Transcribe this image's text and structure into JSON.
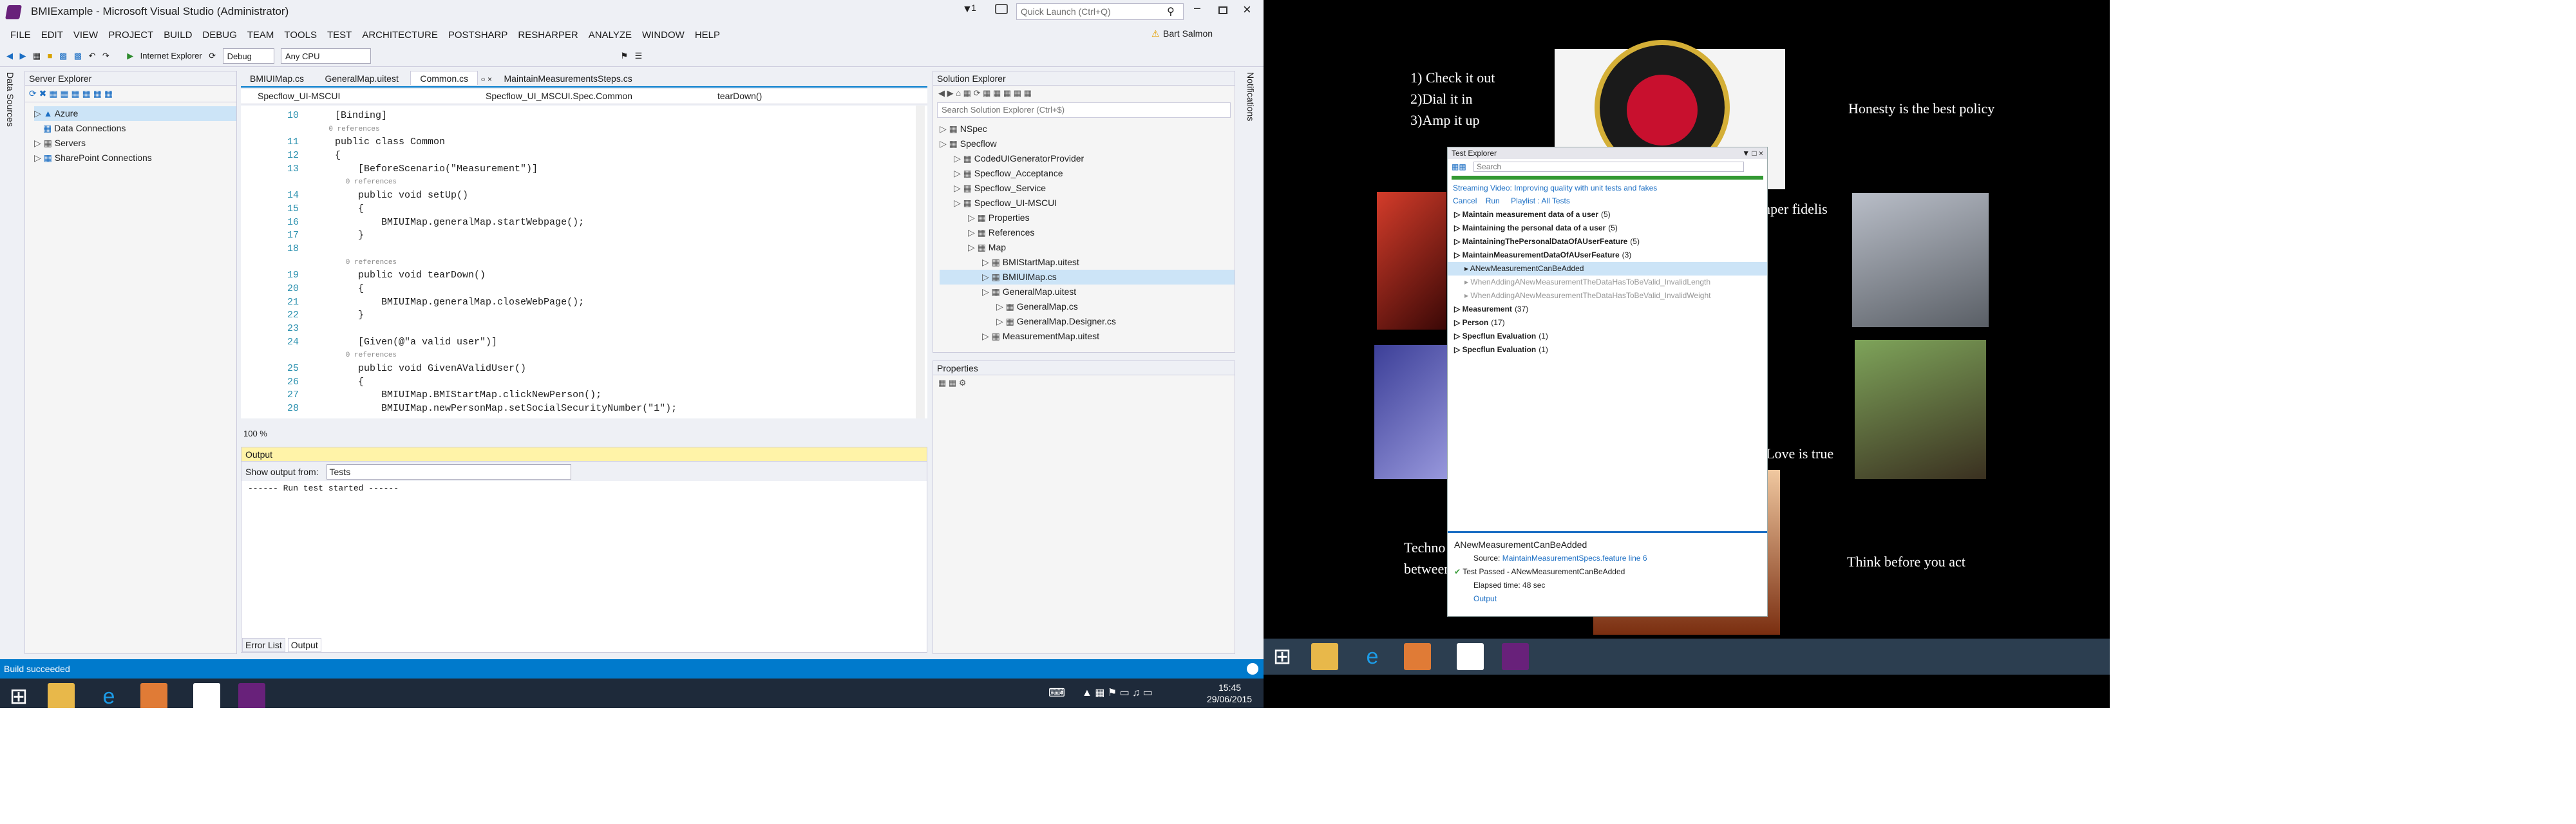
{
  "window": {
    "title": "BMIExample - Microsoft Visual Studio (Administrator)",
    "notif_count": "1",
    "quick_launch_placeholder": "Quick Launch (Ctrl+Q)",
    "user": "Bart Salmon"
  },
  "menu": [
    "FILE",
    "EDIT",
    "VIEW",
    "PROJECT",
    "BUILD",
    "DEBUG",
    "TEAM",
    "TOOLS",
    "TEST",
    "ARCHITECTURE",
    "POSTSHARP",
    "RESHARPER",
    "ANALYZE",
    "WINDOW",
    "HELP"
  ],
  "toolbar": {
    "browser": "Internet Explorer",
    "config": "Debug",
    "platform": "Any CPU"
  },
  "server_explorer": {
    "title": "Server Explorer",
    "items": [
      "Azure",
      "Data Connections",
      "Servers",
      "SharePoint Connections"
    ]
  },
  "side_tabs": {
    "left": "Data Sources",
    "right": "Notifications"
  },
  "editor": {
    "tabs": [
      "BMIUIMap.cs",
      "GeneralMap.uitest",
      "Common.cs",
      "MaintainMeasurementsSteps.cs"
    ],
    "nav": {
      "project": "Specflow_UI-MSCUI",
      "class": "Specflow_UI_MSCUI.Spec.Common",
      "member": "tearDown()"
    },
    "zoom": "100 %",
    "lines": [
      {
        "n": "10",
        "code": "    [Binding]"
      },
      {
        "n": "",
        "code": "    0 references"
      },
      {
        "n": "11",
        "code": "    public class Common"
      },
      {
        "n": "12",
        "code": "    {"
      },
      {
        "n": "13",
        "code": "        [BeforeScenario(\"Measurement\")]"
      },
      {
        "n": "",
        "code": "        0 references"
      },
      {
        "n": "14",
        "code": "        public void setUp()"
      },
      {
        "n": "15",
        "code": "        {"
      },
      {
        "n": "16",
        "code": "            BMIUIMap.generalMap.startWebpage();"
      },
      {
        "n": "17",
        "code": "        }"
      },
      {
        "n": "18",
        "code": ""
      },
      {
        "n": "",
        "code": "        0 references"
      },
      {
        "n": "19",
        "code": "        public void tearDown()"
      },
      {
        "n": "20",
        "code": "        {"
      },
      {
        "n": "21",
        "code": "            BMIUIMap.generalMap.closeWebPage();"
      },
      {
        "n": "22",
        "code": "        }"
      },
      {
        "n": "23",
        "code": ""
      },
      {
        "n": "24",
        "code": "        [Given(@\"a valid user\")]"
      },
      {
        "n": "",
        "code": "        0 references"
      },
      {
        "n": "25",
        "code": "        public void GivenAValidUser()"
      },
      {
        "n": "26",
        "code": "        {"
      },
      {
        "n": "27",
        "code": "            BMIUIMap.BMIStartMap.clickNewPerson();"
      },
      {
        "n": "28",
        "code": "            BMIUIMap.newPersonMap.setSocialSecurityNumber(\"1\");"
      }
    ]
  },
  "output": {
    "title": "Output",
    "show_from_label": "Show output from:",
    "source": "Tests",
    "text": "------ Run test started ------",
    "tabs": [
      "Error List",
      "Output"
    ]
  },
  "solution_explorer": {
    "title": "Solution Explorer",
    "search_placeholder": "Search Solution Explorer (Ctrl+$)",
    "items": [
      "NSpec",
      "Specflow",
      "CodedUIGeneratorProvider",
      "Specflow_Acceptance",
      "Specflow_Service",
      "Specflow_UI-MSCUI",
      "Properties",
      "References",
      "Map",
      "BMIStartMap.uitest",
      "BMIUIMap.cs",
      "GeneralMap.uitest",
      "GeneralMap.cs",
      "GeneralMap.Designer.cs",
      "MeasurementMap.uitest"
    ]
  },
  "properties": {
    "title": "Properties"
  },
  "status": {
    "text": "Build succeeded"
  },
  "tray": {
    "time": "15:45",
    "date": "29/06/2015"
  },
  "desktop": {
    "quotes": [
      "1) Check it out",
      "2)Dial it in",
      "3)Amp it up",
      "Honesty is the best policy",
      "mper fidelis",
      "Love is true",
      "Techno",
      "between ide",
      "Think before you act"
    ]
  },
  "test_explorer": {
    "title": "Test Explorer",
    "search_placeholder": "Search",
    "actions": {
      "cancel": "Cancel",
      "run": "Run",
      "playlist": "Playlist : All Tests"
    },
    "banner": "Streaming Video: Improving quality with unit tests and fakes",
    "groups": [
      {
        "label": "Maintain measurement data of a user",
        "count": "(5)"
      },
      {
        "label": "Maintaining the personal data of a user",
        "count": "(5)"
      },
      {
        "label": "MaintainingThePersonalDataOfAUserFeature",
        "count": "(5)"
      },
      {
        "label": "MaintainMeasurementDataOfAUserFeature",
        "count": "(3)"
      },
      {
        "label": "ANewMeasurementCanBeAdded",
        "count": ""
      },
      {
        "label": "WhenAddingANewMeasurementTheDataHasToBeValid_InvalidLength",
        "count": ""
      },
      {
        "label": "WhenAddingANewMeasurementTheDataHasToBeValid_InvalidWeight",
        "count": ""
      },
      {
        "label": "Measurement",
        "count": "(37)"
      },
      {
        "label": "Person",
        "count": "(17)"
      },
      {
        "label": "Specflun Evaluation",
        "count": "(1)"
      },
      {
        "label": "Specflun Evaluation",
        "count": "(1)"
      }
    ],
    "detail": {
      "name": "ANewMeasurementCanBeAdded",
      "source_label": "Source:",
      "source": "MaintainMeasurementSpecs.feature line 6",
      "result": "Test Passed - ANewMeasurementCanBeAdded",
      "elapsed": "Elapsed time: 48 sec",
      "output_link": "Output"
    }
  },
  "colors": {
    "vs_blue": "#007acc",
    "vs_purple": "#68217a",
    "desktop_bg": "#000000",
    "pass_green": "#339933"
  }
}
